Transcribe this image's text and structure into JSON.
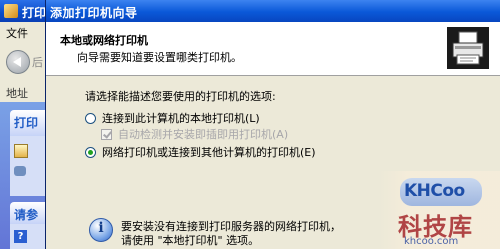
{
  "background_window": {
    "title": "打印",
    "menu_file": "文件",
    "back_label": "后",
    "address_label": "地址",
    "task_section1": "打印",
    "task_section2": "请参"
  },
  "wizard": {
    "title": "添加打印机向导",
    "header": {
      "title": "本地或网络打印机",
      "subtitle": "向导需要知道要设置哪类打印机。"
    },
    "prompt": "请选择能描述您要使用的打印机的选项:",
    "options": [
      {
        "label": "连接到此计算机的本地打印机(L)",
        "checked": false
      },
      {
        "label": "自动检测并安装即插即用打印机(A)",
        "checked": true,
        "disabled": true
      },
      {
        "label": "网络打印机或连接到其他计算机的打印机(E)",
        "checked": true
      }
    ],
    "info_line1": "要安装没有连接到打印服务器的网络打印机，",
    "info_line2": "请使用 \"本地打印机\" 选项。"
  },
  "watermark": {
    "logo": "KHCoo",
    "cn": "科技库",
    "url": "khcoo.com"
  }
}
